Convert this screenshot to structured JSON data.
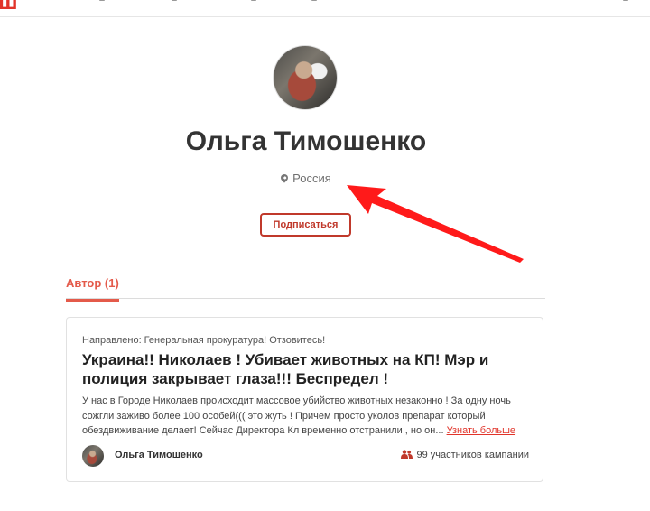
{
  "header": {
    "logo": "ш"
  },
  "profile": {
    "name": "Ольга Тимошенко",
    "location": "Россия",
    "subscribe_label": "Подписаться"
  },
  "tabs": [
    {
      "label": "Автор (1)"
    }
  ],
  "petition": {
    "directed_to": "Направлено: Генеральная прокуратура! Отзовитесь!",
    "title": "Украина!! Николаев ! Убивает животных на КП! Мэр и полиция закрывает глаза!!! Беспредел !",
    "excerpt": "У нас в Городе Николаев происходит массовое убийство животных незаконно ! За одну ночь сожгли заживо более 100 особей((( это жуть ! Причем просто уколов препарат который обездвиживание делает! Сейчас Директора Кл временно отстранили , но он...",
    "more_label": "Узнать больше",
    "author": "Ольга Тимошенко",
    "participants": "99 участников кампании"
  },
  "colors": {
    "brand": "#e1342a",
    "accent": "#e45a4a",
    "button": "#c0392b",
    "arrow": "#ff1a1a"
  },
  "icons": [
    "location-pin-icon",
    "users-icon"
  ]
}
